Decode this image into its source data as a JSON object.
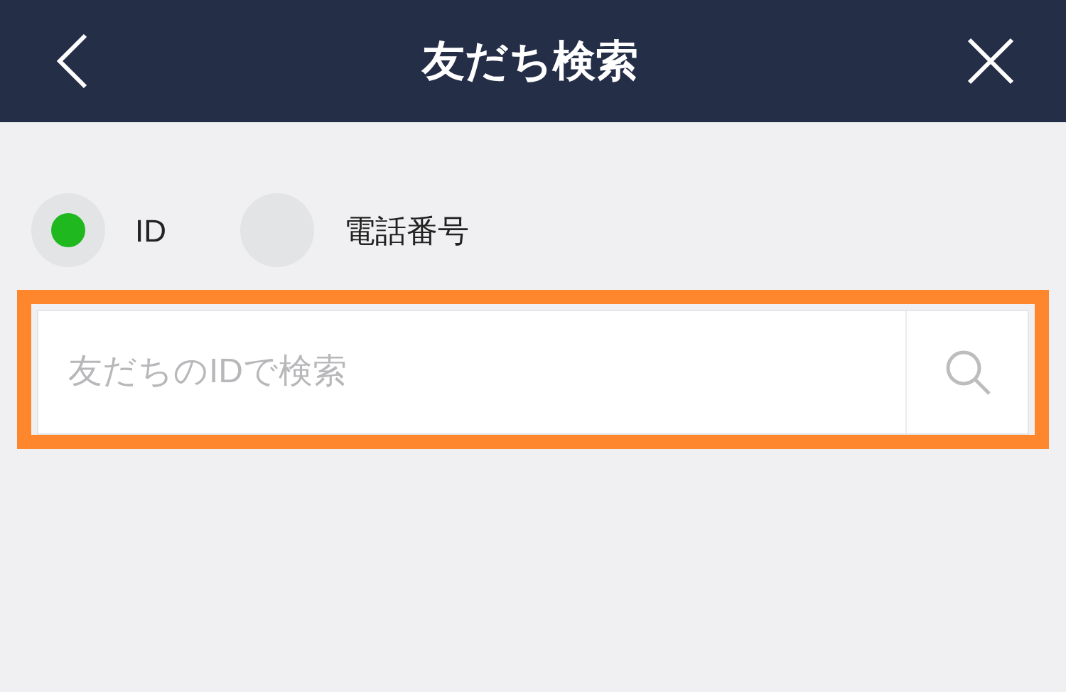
{
  "header": {
    "title": "友だち検索"
  },
  "search_type": [
    {
      "label": "ID",
      "selected": true
    },
    {
      "label": "電話番号",
      "selected": false
    }
  ],
  "search": {
    "placeholder": "友だちのIDで検索"
  }
}
